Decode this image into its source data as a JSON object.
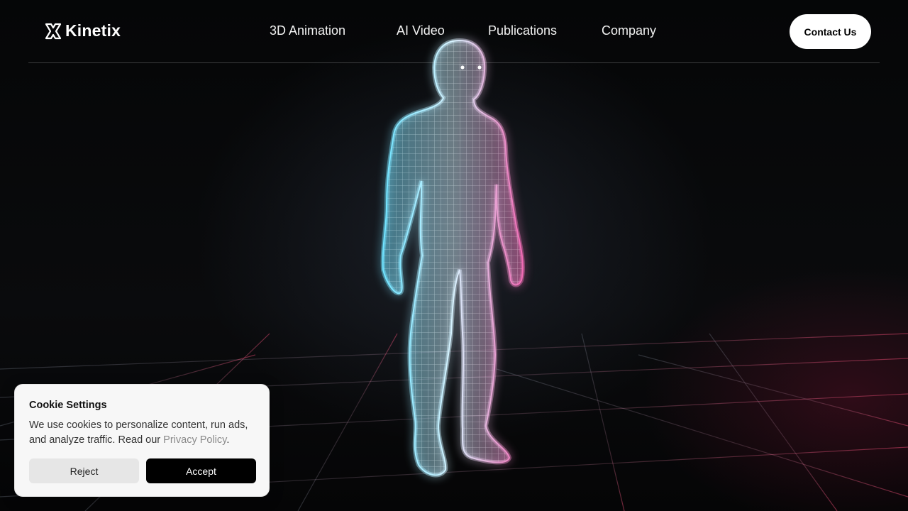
{
  "brand": {
    "name": "Kinetix",
    "logo_icon": "x-mark-logo-icon"
  },
  "nav": {
    "items": [
      {
        "label": "3D Animation"
      },
      {
        "label": "AI Video"
      },
      {
        "label": "Publications"
      },
      {
        "label": "Company"
      }
    ],
    "contact_label": "Contact Us"
  },
  "hero": {
    "image": "wireframe-human-figure",
    "accent_colors": [
      "#5fd6f0",
      "#e85aa6"
    ]
  },
  "cookie": {
    "title": "Cookie Settings",
    "text_before": "We use cookies to personalize content, run ads, and analyze traffic. Read our ",
    "link": "Privacy Policy",
    "text_after": ".",
    "reject_label": "Reject",
    "accept_label": "Accept"
  }
}
